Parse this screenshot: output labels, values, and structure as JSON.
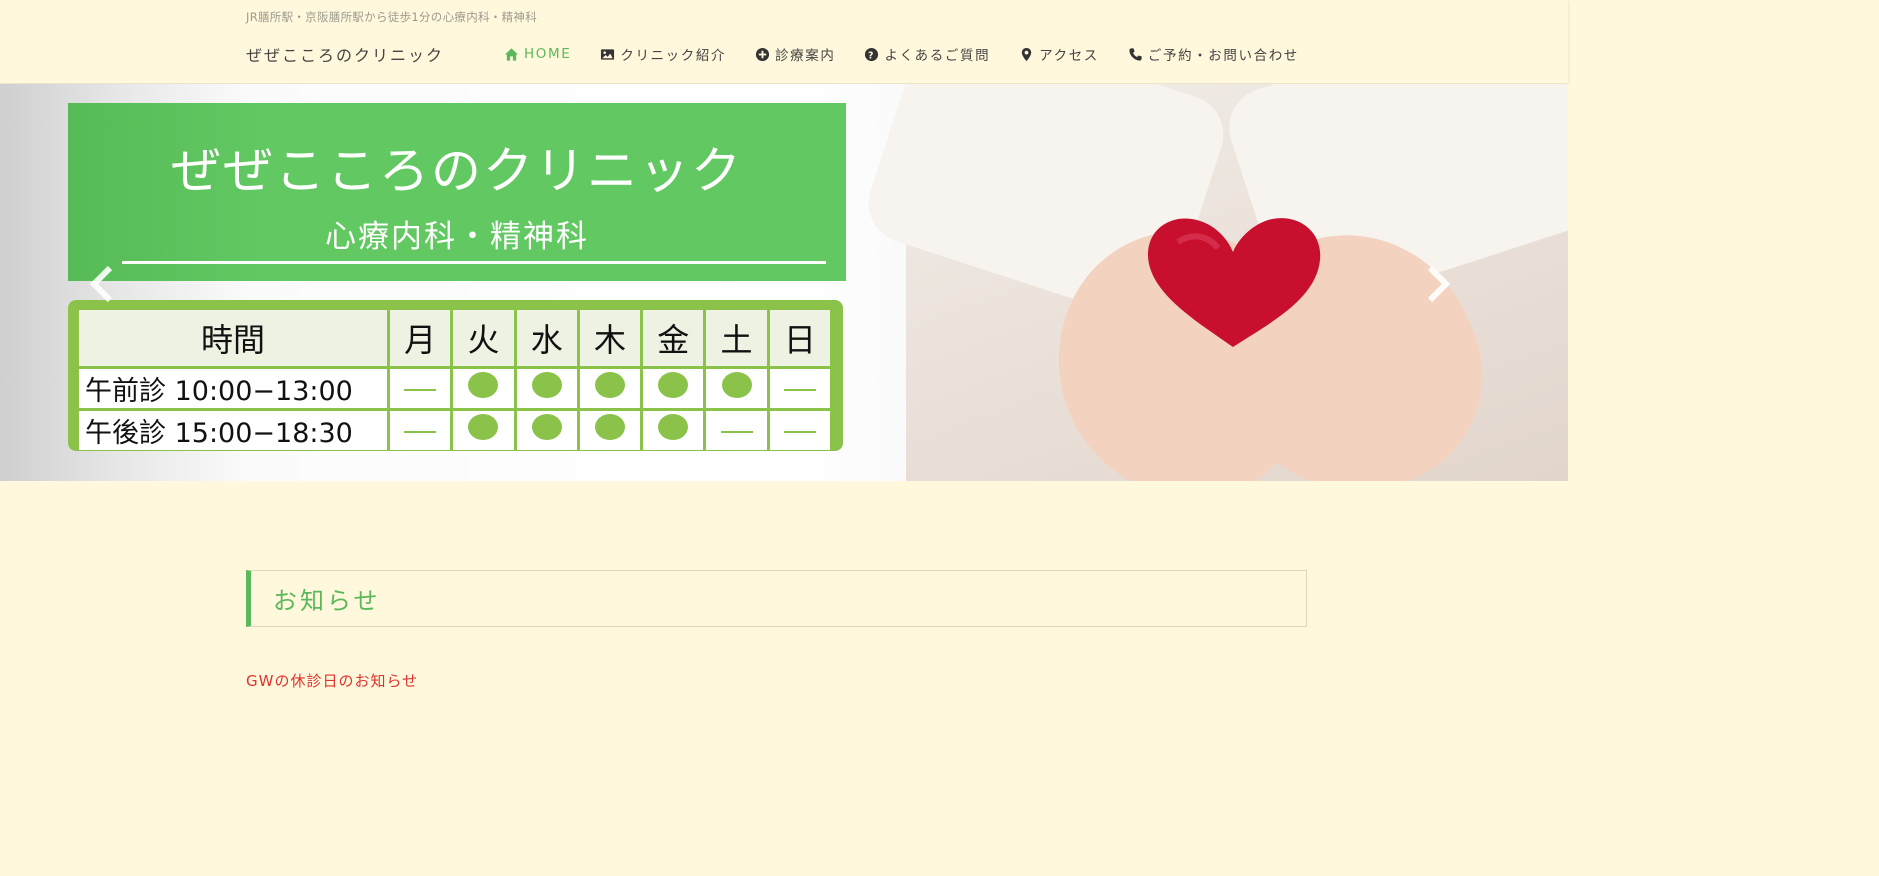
{
  "header": {
    "tagline": "JR膳所駅・京阪膳所駅から徒歩1分の心療内科・精神科",
    "site_title": "ぜぜこころのクリニック"
  },
  "nav": {
    "items": [
      {
        "label": "HOME",
        "icon": "home-icon",
        "active": true
      },
      {
        "label": "クリニック紹介",
        "icon": "image-icon",
        "active": false
      },
      {
        "label": "診療案内",
        "icon": "plus-circle-icon",
        "active": false
      },
      {
        "label": "よくあるご質問",
        "icon": "question-circle-icon",
        "active": false
      },
      {
        "label": "アクセス",
        "icon": "map-marker-icon",
        "active": false
      },
      {
        "label": "ご予約・お問い合わせ",
        "icon": "phone-icon",
        "active": false
      }
    ],
    "active_color": "#5cb85c"
  },
  "slider": {
    "banner_title": "ぜぜこころのクリニック",
    "banner_subtitle": "心療内科・精神科",
    "schedule": {
      "header": [
        "時間",
        "月",
        "火",
        "水",
        "木",
        "金",
        "土",
        "日"
      ],
      "rows": [
        {
          "label": "午前診 10:00−13:00",
          "marks": [
            "—",
            "●",
            "●",
            "●",
            "●",
            "●",
            "—"
          ]
        },
        {
          "label": "午後診 15:00−18:30",
          "marks": [
            "—",
            "●",
            "●",
            "●",
            "●",
            "—",
            "—"
          ]
        }
      ]
    }
  },
  "notice": {
    "title": "お知らせ",
    "first_item": "GWの休診日のお知らせ"
  },
  "colors": {
    "background": "#fff8dc",
    "green": "#5cb85c",
    "link_red": "#e0322f"
  }
}
